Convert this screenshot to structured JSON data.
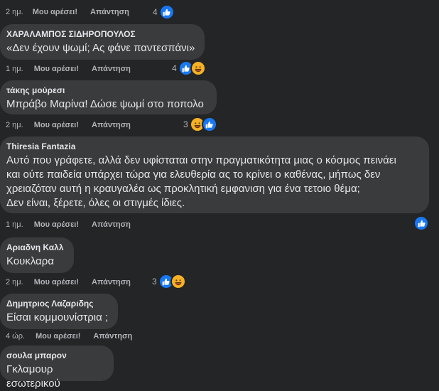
{
  "actions": {
    "like": "Μου αρέσει!",
    "reply": "Απάντηση"
  },
  "icons": {
    "like": "like-reaction-icon",
    "haha": "haha-reaction-icon"
  },
  "colors": {
    "background": "#242526",
    "bubble": "#3a3b3c",
    "like_blue": "#1877f2",
    "haha_yellow": "#f7b125"
  },
  "top_row": {
    "time": "2 ημ.",
    "reaction_count": "4"
  },
  "comments": [
    {
      "author": "ΧΑΡΑΛΑΜΠΟΣ ΣΙΔΗΡΟΠΟΥΛΟΣ",
      "text": "«Δεν έχουν ψωμί; Ας φάνε παντεσπάνι»",
      "time": "1 ημ.",
      "reaction_count": "4"
    },
    {
      "author": "τάκης μούρεσι",
      "text": "Μπράβο Μαρίνα! Δώσε ψωμί στο ποπολο",
      "time": "2 ημ.",
      "reaction_count": "3"
    },
    {
      "author": "Thiresia Fantazia",
      "text": "Αυτό που γράφετε, αλλά δεν υφίσταται στην πραγματικότητα μιας ο κόσμος πεινάει\nκαι ούτε παιδεία υπάρχει τώρα για ελευθερία ας το κρίνει ο καθένας, μήπως δεν\nχρειαζόταν αυτή η κραυγαλέα ως προκλητική εμφανιση για ένα τετοιο θέμα;\nΔεν είναι, ξέρετε, όλες οι στιγμές ίδιες.",
      "time": "1 ημ.",
      "reaction_count": ""
    },
    {
      "author": "Αριαδνη Καλλ",
      "text": "Κουκλαρα",
      "time": "2 ημ.",
      "reaction_count": "3"
    },
    {
      "author": "Δημητριος Λαζαριδης",
      "text": "Είσαι κομμουνίστρια ;",
      "time": "4 ώρ.",
      "reaction_count": ""
    },
    {
      "author": "σουλα μπαρον",
      "text": "Γκλαμουρ εσωτερικού",
      "time": "",
      "reaction_count": ""
    }
  ]
}
